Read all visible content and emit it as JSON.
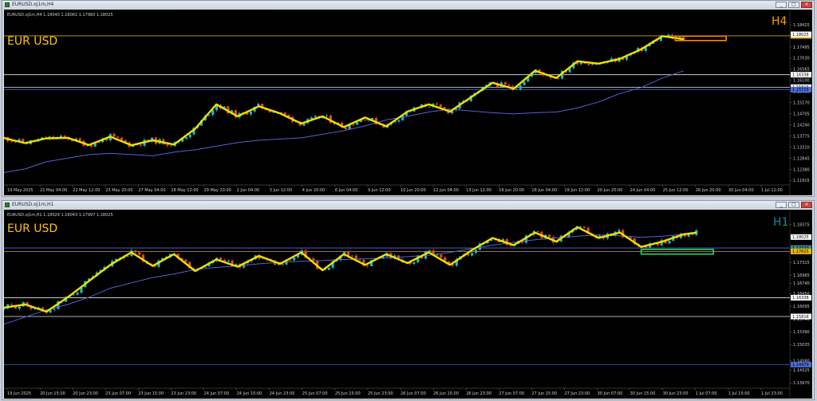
{
  "windows": [
    {
      "id": "h4",
      "title": "EURUSD.oj1m,H4",
      "info_line": "EURUSD.oj1m,H4  1.18040 1.18061 1.17960 1.18025",
      "symbol_label": "EUR USD",
      "timeframe_label": "H4",
      "window_buttons": [
        "_",
        "□",
        "×"
      ],
      "colors": {
        "symbol": "#ffc20e",
        "timeframe": "#ff9f00",
        "box": "#ff8c00"
      },
      "price_axis": {
        "ticks": [
          "1.18425",
          "1.17960",
          "1.17495",
          "1.17030",
          "1.16565",
          "1.16100",
          "1.15635",
          "1.15170",
          "1.14705",
          "1.14240",
          "1.13775",
          "1.13310",
          "1.12845",
          "1.12380",
          "1.11915"
        ],
        "tick_values": [
          1.18425,
          1.1796,
          1.17495,
          1.1703,
          1.16565,
          1.161,
          1.15635,
          1.1517,
          1.14705,
          1.1424,
          1.13775,
          1.1331,
          1.12845,
          1.1238,
          1.11915
        ]
      },
      "time_axis": [
        "19 May 2025",
        "21 May 04:00",
        "22 May 12:00",
        "23 May 20:00",
        "27 May 04:00",
        "28 May 12:00",
        "29 May 20:00",
        "2 Jun 04:00",
        "3 Jun 12:00",
        "4 Jun 20:00",
        "6 Jun 04:00",
        "9 Jun 12:00",
        "10 Jun 20:00",
        "12 Jun 04:00",
        "13 Jun 12:00",
        "16 Jun 20:00",
        "18 Jun 04:00",
        "19 Jun 12:00",
        "20 Jun 20:00",
        "24 Jun 04:00",
        "25 Jun 12:00",
        "26 Jun 20:00",
        "30 Jun 04:00",
        "1 Jul 12:00"
      ],
      "price_lines": [
        {
          "value": 1.17963,
          "color": "#d9a400",
          "label": "1.17963",
          "label_bg": "#f0b800"
        },
        {
          "value": 1.16338,
          "color": "#e8e8e8",
          "label": "1.16338",
          "label_bg": "#ffffff"
        },
        {
          "value": 1.15816,
          "color": "#e8e8e8",
          "label": "1.15816",
          "label_bg": "#ffffff"
        },
        {
          "value": 1.15715,
          "color": "#4a6ed8",
          "label": "1.15715",
          "label_bg": "#4a6ed8"
        }
      ],
      "current_price": {
        "value": 1.18025,
        "label": "1.18025"
      },
      "highlight_box": {
        "x_from": 158,
        "x_to": 170,
        "y_from": 1.17765,
        "y_to": 1.1795
      },
      "chart_data": {
        "type": "line",
        "title": "EURUSD.oj1m,H4",
        "xlabel": "",
        "ylabel": "",
        "ylim": [
          1.1173,
          1.1866
        ],
        "x": [
          0,
          5,
          10,
          15,
          20,
          25,
          30,
          35,
          40,
          45,
          50,
          55,
          60,
          65,
          70,
          75,
          80,
          85,
          90,
          95,
          100,
          105,
          110,
          115,
          120,
          125,
          130,
          135,
          140,
          145,
          150,
          155,
          160
        ],
        "series": [
          {
            "name": "",
            "color": "#f0e000",
            "values": [
              1.1369,
              1.1348,
              1.1368,
              1.137,
              1.134,
              1.1375,
              1.1339,
              1.136,
              1.1342,
              1.1408,
              1.151,
              1.146,
              1.1502,
              1.1472,
              1.143,
              1.146,
              1.1415,
              1.1455,
              1.1418,
              1.148,
              1.151,
              1.148,
              1.154,
              1.16,
              1.1575,
              1.165,
              1.162,
              1.169,
              1.168,
              1.17,
              1.174,
              1.1795,
              1.1782
            ]
          },
          {
            "name": "",
            "color": "#5560d8",
            "values": [
              1.1225,
              1.124,
              1.127,
              1.1285,
              1.13,
              1.1305,
              1.13,
              1.1295,
              1.131,
              1.132,
              1.1335,
              1.135,
              1.136,
              1.1365,
              1.137,
              1.1385,
              1.14,
              1.142,
              1.1445,
              1.146,
              1.1478,
              1.149,
              1.1482,
              1.1475,
              1.147,
              1.1475,
              1.1478,
              1.1495,
              1.152,
              1.1555,
              1.158,
              1.162,
              1.165
            ]
          }
        ]
      }
    },
    {
      "id": "h1",
      "title": "EURUSD.oj1m,H1",
      "info_line": "EURUSD.oj1m,H1  1.18029 1.18043 1.17997 1.18025",
      "symbol_label": "EUR USD",
      "timeframe_label": "H1",
      "window_buttons": [
        "_",
        "□",
        "×"
      ],
      "colors": {
        "symbol": "#ffc20e",
        "timeframe": "#138c97",
        "box": "#2fd06e"
      },
      "price_axis": {
        "ticks": [
          "1.18375",
          "1.18025",
          "1.17670",
          "1.17315",
          "1.16965",
          "1.16740",
          "1.16450",
          "1.16095",
          "1.15740",
          "1.15390",
          "1.15035",
          "1.14580",
          "1.14325",
          "1.13970"
        ],
        "tick_values": [
          1.18375,
          1.18025,
          1.1767,
          1.17315,
          1.16965,
          1.1674,
          1.1645,
          1.16095,
          1.1574,
          1.1539,
          1.15035,
          1.1458,
          1.14325,
          1.1397
        ]
      },
      "time_axis": [
        "19 Jun 2025",
        "20 Jun 15:00",
        "20 Jun 23:00",
        "23 Jun 07:00",
        "23 Jun 15:00",
        "23 Jun 23:00",
        "24 Jun 07:00",
        "24 Jun 15:00",
        "24 Jun 23:00",
        "25 Jun 07:00",
        "25 Jun 15:00",
        "25 Jun 23:00",
        "26 Jun 07:00",
        "26 Jun 15:00",
        "26 Jun 23:00",
        "27 Jun 07:00",
        "27 Jun 15:00",
        "27 Jun 23:00",
        "30 Jun 07:00",
        "30 Jun 15:00",
        "30 Jun 23:00",
        "1 Jul 07:00",
        "1 Jul 15:00",
        "1 Jul 23:00"
      ],
      "price_lines": [
        {
          "value": 1.1772,
          "color": "#4a6ed8",
          "label": "1.17720",
          "label_bg": "#2f8c8c"
        },
        {
          "value": 1.17625,
          "color": "#d9a400",
          "label": "1.17625",
          "label_bg": "#f0b800"
        },
        {
          "value": 1.16338,
          "color": "#e8e8e8",
          "label": "1.16338",
          "label_bg": "#ffffff"
        },
        {
          "value": 1.15816,
          "color": "#e8e8e8",
          "label": "1.15816",
          "label_bg": "#ffffff"
        },
        {
          "value": 1.14479,
          "color": "#4a6ed8",
          "label": "1.14479",
          "label_bg": "#4a6ed8"
        }
      ],
      "current_price": {
        "value": 1.18025,
        "label": "1.18025"
      },
      "highlight_box": {
        "x_from": 150,
        "x_to": 167,
        "y_from": 1.1755,
        "y_to": 1.1768
      },
      "chart_data": {
        "type": "line",
        "title": "EURUSD.oj1m,H1",
        "xlabel": "",
        "ylabel": "",
        "ylim": [
          1.1382,
          1.1852
        ],
        "x": [
          0,
          5,
          10,
          15,
          20,
          25,
          30,
          35,
          40,
          45,
          50,
          55,
          60,
          65,
          70,
          75,
          80,
          85,
          90,
          95,
          100,
          105,
          110,
          115,
          120,
          125,
          130,
          135,
          140,
          145,
          150,
          155,
          160,
          163
        ],
        "series": [
          {
            "name": "",
            "color": "#f0e000",
            "values": [
              1.1606,
              1.1615,
              1.1595,
              1.1635,
              1.168,
              1.1725,
              1.176,
              1.1722,
              1.1755,
              1.1708,
              1.174,
              1.172,
              1.175,
              1.1728,
              1.176,
              1.171,
              1.1755,
              1.1725,
              1.1755,
              1.173,
              1.176,
              1.1725,
              1.1765,
              1.18,
              1.178,
              1.1815,
              1.179,
              1.183,
              1.18,
              1.1815,
              1.1775,
              1.179,
              1.181,
              1.1815
            ]
          },
          {
            "name": "",
            "color": "#5560d8",
            "values": [
              1.156,
              1.158,
              1.16,
              1.1615,
              1.1635,
              1.166,
              1.1675,
              1.169,
              1.17,
              1.1712,
              1.1718,
              1.1722,
              1.1728,
              1.1732,
              1.1735,
              1.1737,
              1.174,
              1.1742,
              1.1744,
              1.1748,
              1.1752,
              1.176,
              1.177,
              1.178,
              1.1788,
              1.1795,
              1.18,
              1.1805,
              1.1808,
              1.1806,
              1.1802,
              1.1805,
              1.181,
              1.1812
            ]
          }
        ]
      }
    }
  ]
}
